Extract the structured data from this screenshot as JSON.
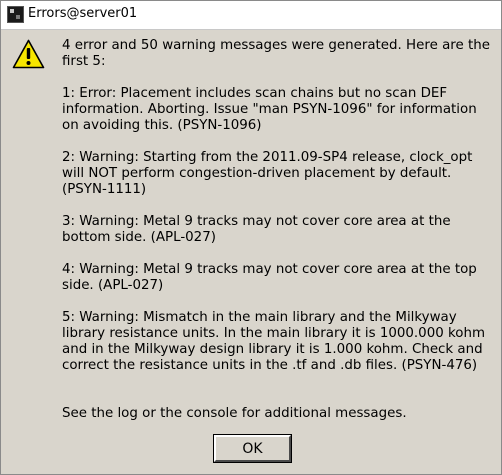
{
  "window": {
    "title": "Errors@server01"
  },
  "dialog": {
    "icon": "warning-icon",
    "messages": [
      "4 error and 50 warning messages were generated.  Here are the first 5:",
      "1: Error: Placement includes scan chains but no scan DEF information. Aborting. Issue \"man PSYN-1096\" for information on avoiding this. (PSYN-1096)",
      "2: Warning: Starting from the 2011.09-SP4 release, clock_opt will NOT perform congestion-driven placement by default. (PSYN-1111)",
      "3: Warning: Metal 9 tracks may not cover core area at the bottom side. (APL-027)",
      "4: Warning: Metal 9 tracks may not cover core area at the top side. (APL-027)",
      "5: Warning: Mismatch in the main library and the Milkyway library resistance units. In the main library it is 1000.000 kohm and in the Milkyway design library it is 1.000 kohm. Check and correct the resistance units in the .tf and .db files. (PSYN-476)"
    ],
    "footer": "See the log or the console for additional messages.",
    "ok_label": "OK"
  },
  "colors": {
    "background": "#d9d5cc",
    "titlebar": "#ffffff",
    "warning_fill": "#f7e600"
  }
}
